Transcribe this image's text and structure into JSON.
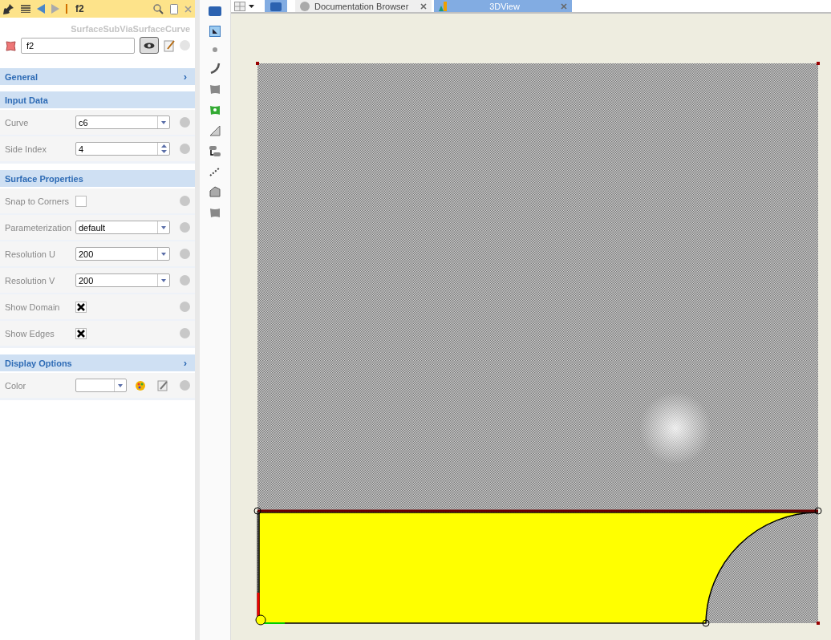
{
  "panel": {
    "title": "f2",
    "type_name": "SurfaceSubViaSurfaceCurve",
    "name_value": "f2",
    "sections": [
      {
        "title": "General",
        "arrow": "›"
      },
      {
        "title": "Input Data",
        "rows": [
          {
            "kind": "combo",
            "label": "Curve",
            "value": "c6"
          },
          {
            "kind": "spin",
            "label": "Side Index",
            "value": "4"
          }
        ]
      },
      {
        "title": "Surface Properties",
        "rows": [
          {
            "kind": "check",
            "label": "Snap to Corners",
            "checked": false
          },
          {
            "kind": "combo",
            "label": "Parameterization",
            "value": "default"
          },
          {
            "kind": "combo",
            "label": "Resolution U",
            "value": "200"
          },
          {
            "kind": "combo",
            "label": "Resolution V",
            "value": "200"
          },
          {
            "kind": "check",
            "label": "Show Domain",
            "checked": true
          },
          {
            "kind": "check",
            "label": "Show Edges",
            "checked": true
          }
        ]
      },
      {
        "title": "Display Options",
        "arrow": "›",
        "rows": [
          {
            "kind": "color",
            "label": "Color"
          }
        ]
      }
    ]
  },
  "tabs": [
    {
      "label": "Documentation Browser",
      "selected": false,
      "kind": "doc"
    },
    {
      "label": "3DView",
      "selected": true,
      "kind": "view"
    }
  ]
}
